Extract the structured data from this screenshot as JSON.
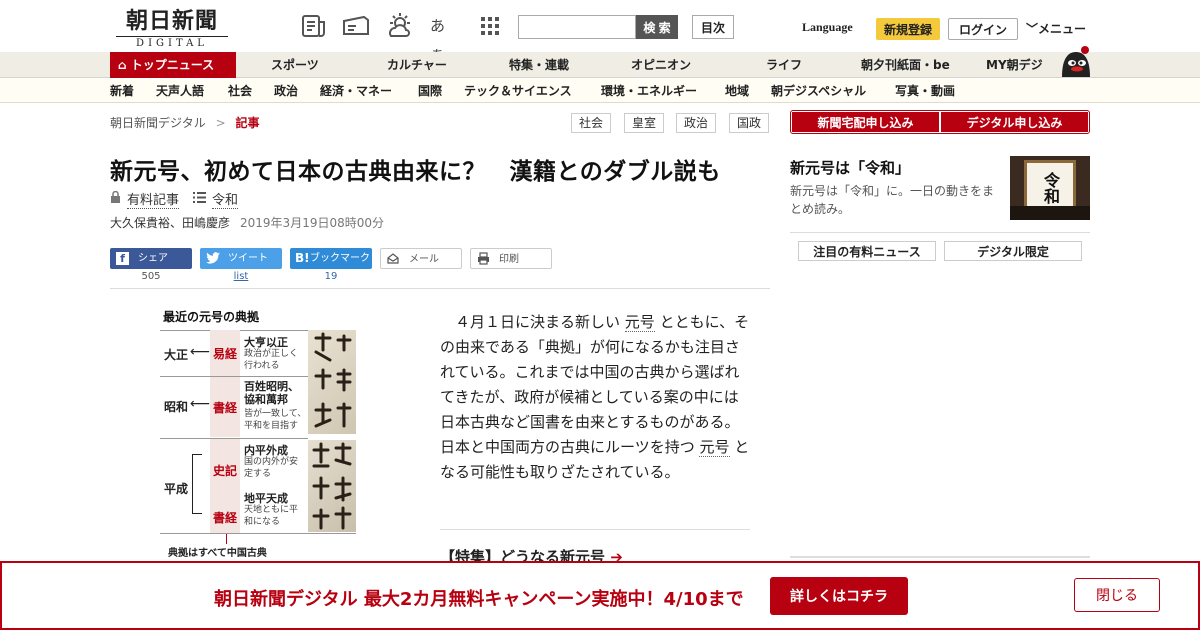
{
  "header": {
    "logo_ja": "朝日新聞",
    "logo_en": "DIGITAL",
    "icons": [
      "newspaper-icon",
      "ticket-icon",
      "weather-icon",
      "font-size-icon",
      "grid-icon"
    ],
    "font_icon_text": "あぁ",
    "search_placeholder": "",
    "search_label": "検 索",
    "toc_label": "目次",
    "language_label": "Language",
    "register_label": "新規登録",
    "login_label": "ログイン",
    "menu_label": "メニュー"
  },
  "nav1": {
    "top_label": "トップニュース",
    "items": [
      "スポーツ",
      "カルチャー",
      "特集・連載",
      "オピニオン",
      "ライフ",
      "朝夕刊紙面・be",
      "MY朝デジ"
    ]
  },
  "nav2": {
    "items": [
      "新着",
      "天声人語",
      "社会",
      "政治",
      "経済・マネー",
      "国際",
      "テック＆サイエンス",
      "環境・エネルギー",
      "地域",
      "朝デジスペシャル",
      "写真・動画"
    ]
  },
  "breadcrumb": {
    "home": "朝日新聞デジタル",
    "sep": ">",
    "current": "記事"
  },
  "tags": [
    "社会",
    "皇室",
    "政治",
    "国政"
  ],
  "article": {
    "headline": "新元号、初めて日本の古典由来に？　漢籍とのダブル説も",
    "paid_label": "有料記事",
    "topic_label": "令和",
    "authors": "大久保貴裕、田嶋慶彦",
    "date": "2019年3月19日08時00分",
    "body_parts": [
      "４月１日に決まる新しい",
      "元号",
      "とともに、その由来である「典拠」が何になるかも注目されている。これまでは中国の古典から選ばれてきたが、政府が候補としている案の中には日本古典など国書を由来とするものがある。日本と中国両方の古典にルーツを持つ",
      "元号",
      "となる可能性も取りざたされている。"
    ],
    "related_link": "【特集】どうなる新元号"
  },
  "share": {
    "facebook": {
      "label": "シェア",
      "count": "505"
    },
    "twitter": {
      "label": "ツイート",
      "count": "list"
    },
    "hatena": {
      "label": "ブックマーク",
      "count": "19"
    },
    "mail": {
      "label": "メール"
    },
    "print": {
      "label": "印刷"
    }
  },
  "figure": {
    "title": "最近の元号の典拠",
    "rows": [
      {
        "era": "大正",
        "source": "易経",
        "phrase": "大亨以正",
        "desc": "政治が正しく行われる"
      },
      {
        "era": "昭和",
        "source": "書経",
        "phrase": "百姓昭明、協和萬邦",
        "desc": "皆が一致して、平和を目指す"
      },
      {
        "era": "平成",
        "source": "史記",
        "phrase": "内平外成",
        "desc": "国の内外が安定する"
      },
      {
        "era": "",
        "source": "書経",
        "phrase": "地平天成",
        "desc": "天地ともに平和になる"
      }
    ],
    "footnote": "典拠はすべて中国古典"
  },
  "sidebar": {
    "subscribe_paper": "新聞宅配申し込み",
    "subscribe_digital": "デジタル申し込み",
    "feature_title": "新元号は「令和」",
    "feature_desc": "新元号は「令和」に。一日の動きをまとめ読み。",
    "feature_image_text": "令和",
    "tab_paid": "注目の有料ニュース",
    "tab_digital": "デジタル限定"
  },
  "banner": {
    "text": "朝日新聞デジタル 最大2カ月無料キャンペーン実施中！4/10まで",
    "detail_label": "詳しくはコチラ",
    "close_label": "閉じる"
  },
  "colors": {
    "brand_red": "#b70010",
    "facebook": "#3b5998",
    "twitter": "#4ba0e8",
    "hatena": "#2f8bd8",
    "register_yellow": "#f4c93c"
  }
}
